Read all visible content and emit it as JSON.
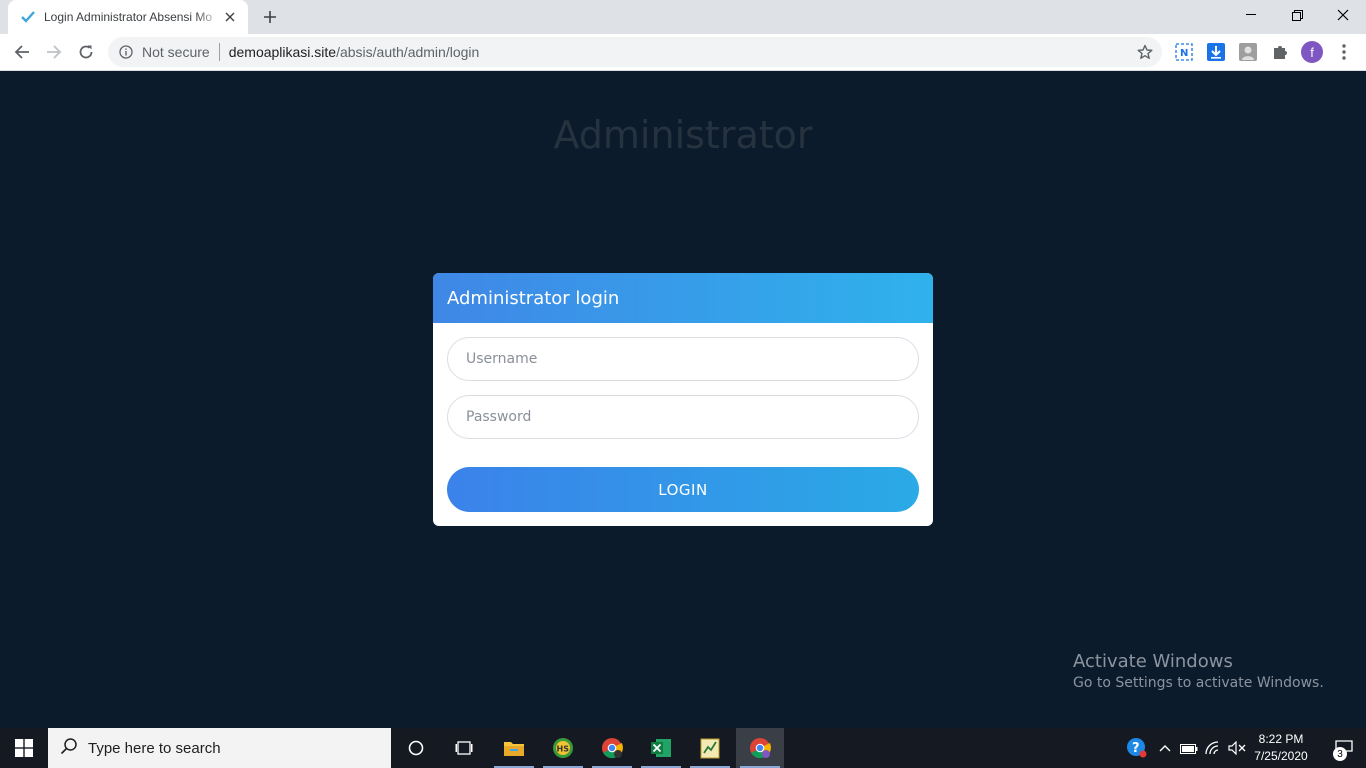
{
  "browser": {
    "tab_title": "Login Administrator Absensi Mo",
    "url_security": "Not secure",
    "url_host": "demoaplikasi.site",
    "url_path": "/absis/auth/admin/login",
    "profile_initial": "f"
  },
  "page": {
    "heading": "Administrator",
    "card_title": "Administrator login",
    "username_placeholder": "Username",
    "password_placeholder": "Password",
    "login_label": "LOGIN",
    "watermark_title": "Activate Windows",
    "watermark_sub": "Go to Settings to activate Windows."
  },
  "taskbar": {
    "search_placeholder": "Type here to search",
    "time": "8:22 PM",
    "date": "7/25/2020",
    "notification_count": "3"
  },
  "colors": {
    "page_bg": "#0b1b2b",
    "accent_start": "#3b82ea",
    "accent_end": "#2aaae6"
  }
}
